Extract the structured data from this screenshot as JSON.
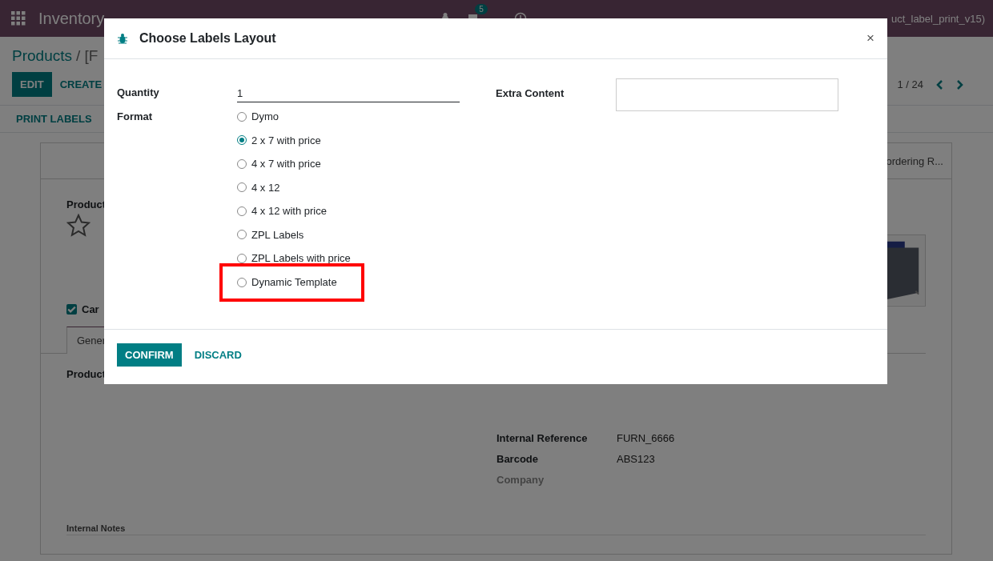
{
  "navbar": {
    "app_name": "Inventory",
    "message_count": "5",
    "user": "uct_label_print_v15)"
  },
  "control_panel": {
    "breadcrumb_parent": "Products",
    "breadcrumb_current": "/ [F",
    "buttons": [
      {
        "label": "EDIT",
        "kind": "primary"
      },
      {
        "label": "CREATE",
        "kind": "secondary"
      }
    ],
    "pager": "1 / 24"
  },
  "header_buttons": [
    "PRINT LABELS"
  ],
  "form": {
    "smart_button": "ordering R...",
    "name_label": "Product",
    "starred": false,
    "checkbox": {
      "label": "Car",
      "checked": true
    },
    "tabs": [
      {
        "label": "Gener",
        "selected": true
      }
    ],
    "section_label": "Product",
    "fields": [
      {
        "label": "Internal Reference",
        "value": "FURN_6666",
        "muted": false
      },
      {
        "label": "Barcode",
        "value": "ABS123",
        "muted": false
      },
      {
        "label": "Company",
        "muted": true
      }
    ],
    "notes_label": "Internal Notes"
  },
  "dialog": {
    "title": "Choose Labels Layout",
    "close_label": "×",
    "quantity": {
      "label": "Quantity",
      "value": "1"
    },
    "format": {
      "label": "Format",
      "options": [
        {
          "label": "Dymo",
          "selected": false,
          "highlighted": false
        },
        {
          "label": "2 x 7 with price",
          "selected": true,
          "highlighted": false
        },
        {
          "label": "4 x 7 with price",
          "selected": false,
          "highlighted": false
        },
        {
          "label": "4 x 12",
          "selected": false,
          "highlighted": false
        },
        {
          "label": "4 x 12 with price",
          "selected": false,
          "highlighted": false
        },
        {
          "label": "ZPL Labels",
          "selected": false,
          "highlighted": false
        },
        {
          "label": "ZPL Labels with price",
          "selected": false,
          "highlighted": false
        },
        {
          "label": "Dynamic Template",
          "selected": false,
          "highlighted": true
        }
      ]
    },
    "extra_content": {
      "label": "Extra Content"
    },
    "buttons": [
      {
        "label": "CONFIRM",
        "kind": "primary"
      },
      {
        "label": "DISCARD",
        "kind": "link"
      }
    ]
  }
}
